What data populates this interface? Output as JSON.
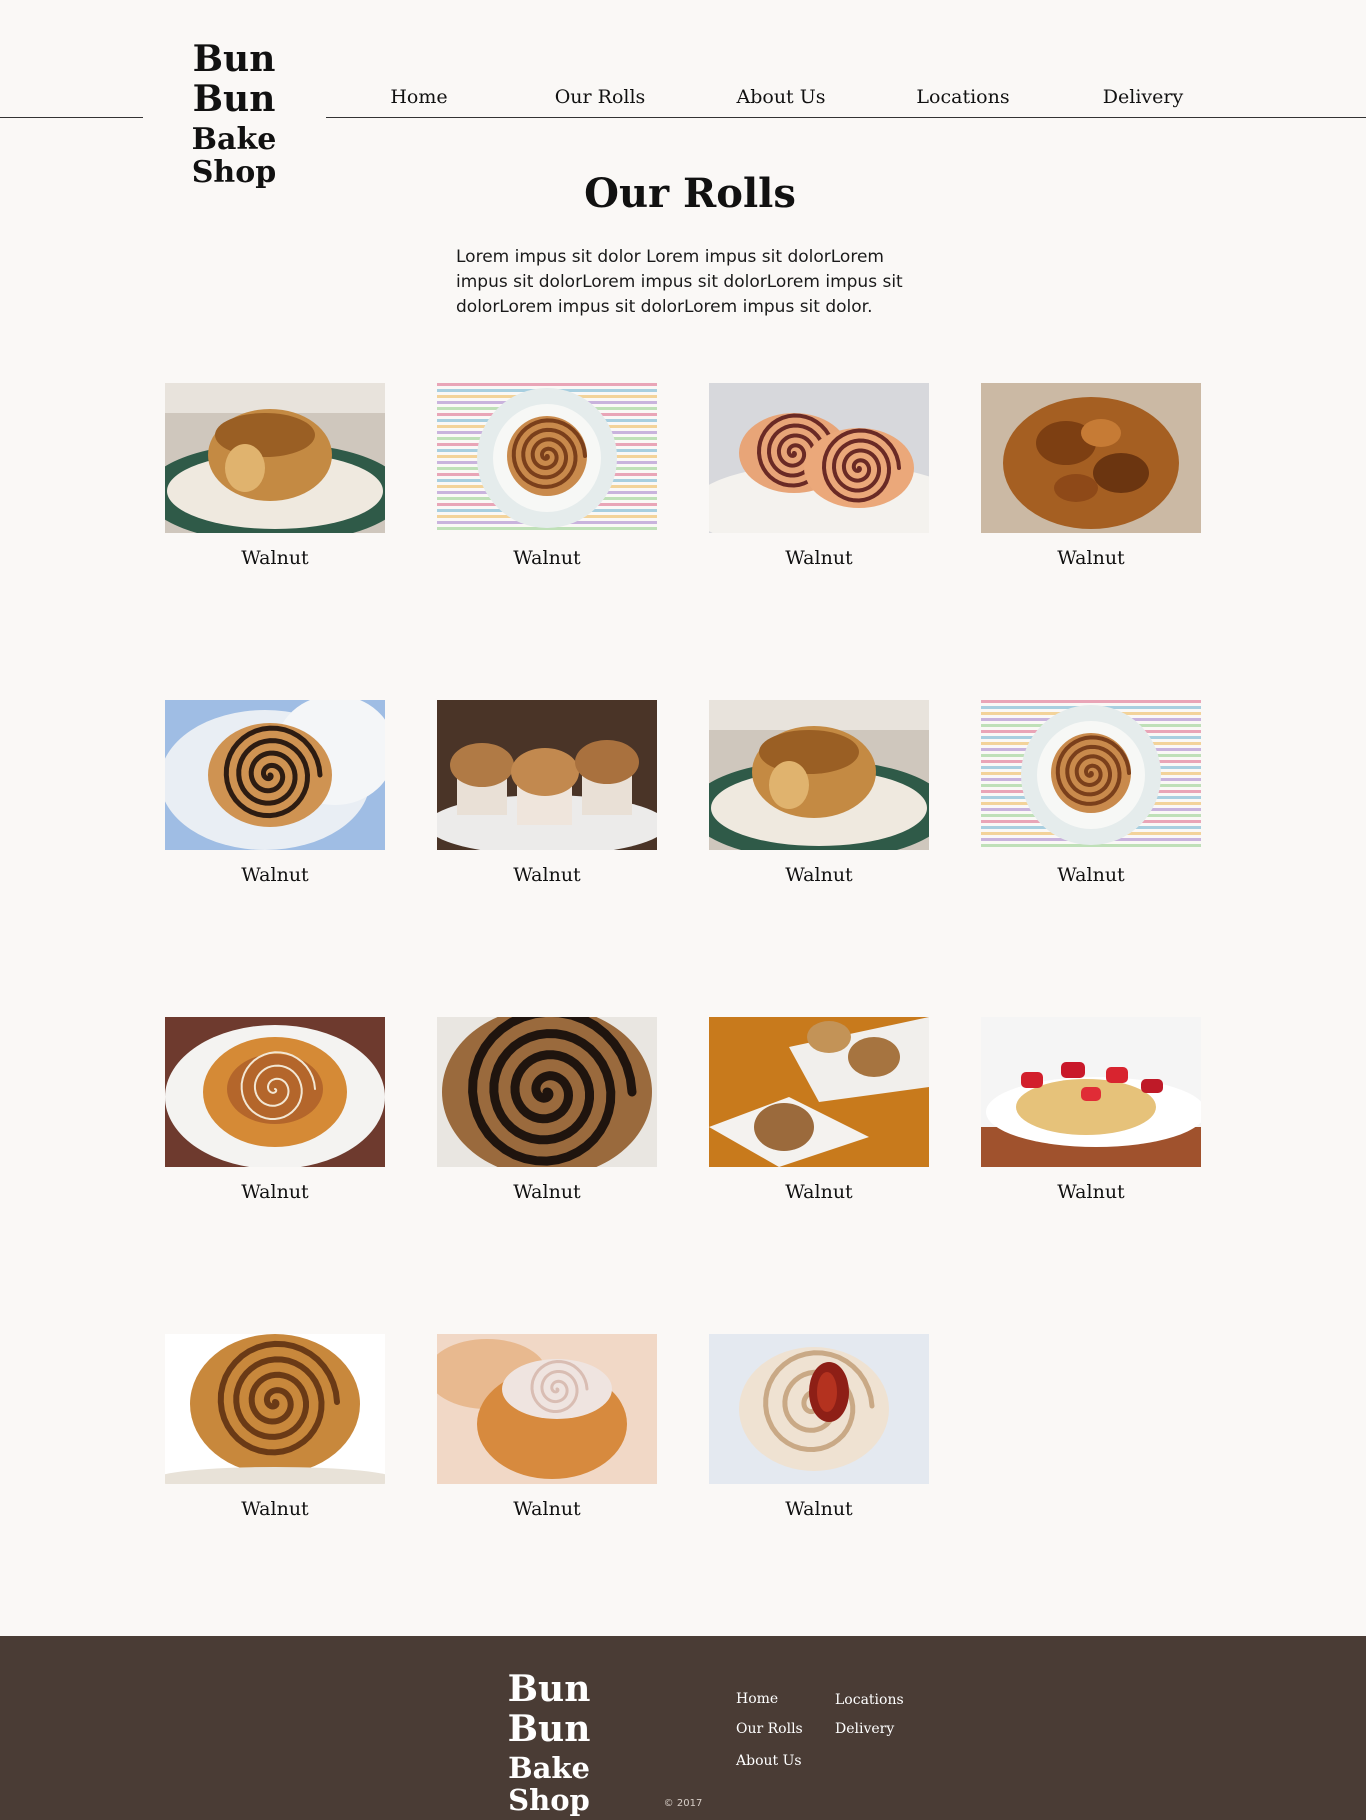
{
  "brand": {
    "line1": "Bun Bun",
    "line2": "Bake Shop"
  },
  "nav": [
    {
      "label": "Home"
    },
    {
      "label": "Our Rolls"
    },
    {
      "label": "About Us"
    },
    {
      "label": "Locations"
    },
    {
      "label": "Delivery"
    }
  ],
  "page": {
    "title": "Our Rolls",
    "intro": "Lorem impus sit dolor Lorem impus sit dolorLorem impus sit dolorLorem impus sit dolorLorem impus sit dolorLorem impus sit dolorLorem impus sit dolor."
  },
  "rolls": [
    {
      "label": "Walnut",
      "photo": "sticky-bun-green-plate"
    },
    {
      "label": "Walnut",
      "photo": "cinnamon-roll-striped-cloth"
    },
    {
      "label": "Walnut",
      "photo": "two-swirl-rolls"
    },
    {
      "label": "Walnut",
      "photo": "pecan-caramel-roll"
    },
    {
      "label": "Walnut",
      "photo": "chocolate-swirl-blue-plate"
    },
    {
      "label": "Walnut",
      "photo": "muffin-rolls"
    },
    {
      "label": "Walnut",
      "photo": "sticky-bun-green-plate"
    },
    {
      "label": "Walnut",
      "photo": "cinnamon-roll-striped-cloth"
    },
    {
      "label": "Walnut",
      "photo": "danish-white-plate"
    },
    {
      "label": "Walnut",
      "photo": "chocolate-swirl-closeup"
    },
    {
      "label": "Walnut",
      "photo": "rolls-on-wood-table"
    },
    {
      "label": "Walnut",
      "photo": "strawberry-pastry"
    },
    {
      "label": "Walnut",
      "photo": "glazed-swirl-white"
    },
    {
      "label": "Walnut",
      "photo": "iced-cinnamon-roll"
    },
    {
      "label": "Walnut",
      "photo": "red-filling-swirl"
    }
  ],
  "footer": {
    "brand": {
      "line1": "Bun Bun",
      "line2": "Bake Shop"
    },
    "links_col1": [
      "Home",
      "Our Rolls",
      "About Us"
    ],
    "links_col2": [
      "Locations",
      "Delivery"
    ],
    "copyright": "© 2017",
    "background": "#4a3c35"
  },
  "colors": {
    "page_background": "#faf8f6",
    "text": "#111111"
  }
}
